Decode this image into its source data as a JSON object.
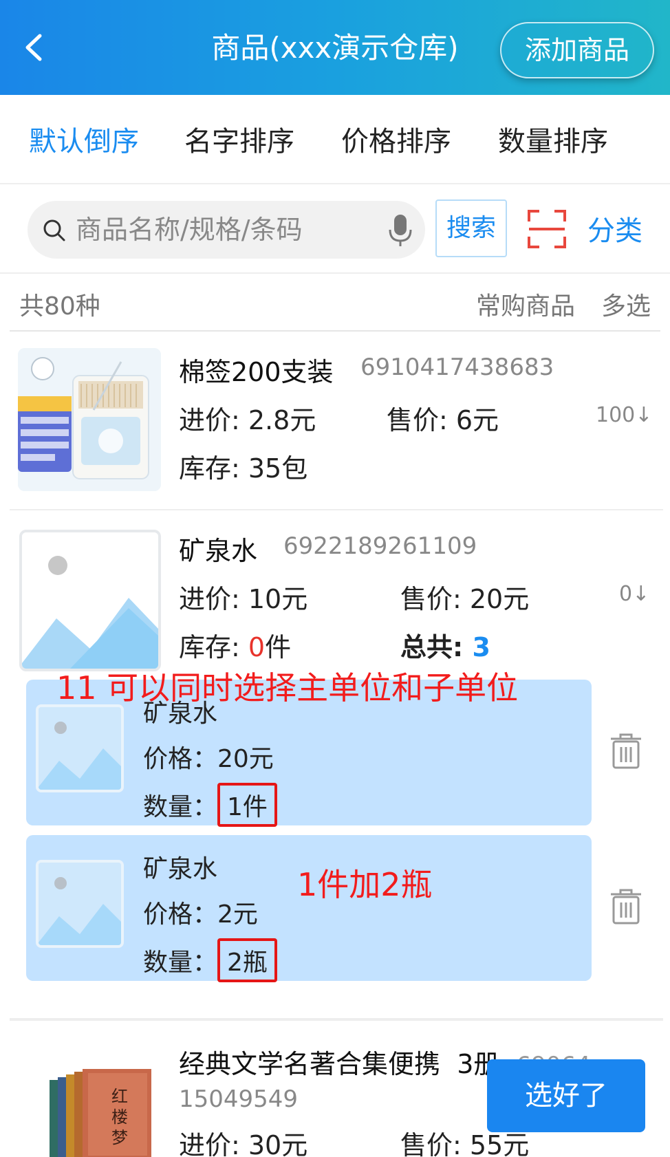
{
  "header": {
    "title": "商品(xxx演示仓库)",
    "add_label": "添加商品"
  },
  "sort_tabs": [
    {
      "label": "默认倒序",
      "active": true
    },
    {
      "label": "名字排序",
      "active": false
    },
    {
      "label": "价格排序",
      "active": false
    },
    {
      "label": "数量排序",
      "active": false
    }
  ],
  "search": {
    "placeholder": "商品名称/规格/条码",
    "button_label": "搜索",
    "category_label": "分类"
  },
  "summary": {
    "total_label": "共80种",
    "frequent_label": "常购商品",
    "multi_label": "多选"
  },
  "products": [
    {
      "name": "棉签200支装",
      "code": "6910417438683",
      "cost": "进价: 2.8元",
      "sale": "售价: 6元",
      "stock": "库存: 35包",
      "side": "100↓"
    },
    {
      "name": "矿泉水",
      "code": "6922189261109",
      "cost": "进价: 10元",
      "sale": "售价: 20元",
      "stock_prefix": "库存: ",
      "stock_value": "0",
      "stock_unit": "件",
      "total_label": "总共: ",
      "total_value": "3",
      "side": "0↓"
    },
    {
      "name": "经典文学名著合集便携",
      "name_suffix": "3册",
      "code_partial": "69064",
      "code": "15049549",
      "cost": "进价: 30元",
      "sale": "售价: 55元"
    }
  ],
  "sub_units": [
    {
      "name": "矿泉水",
      "price": "价格：20元",
      "qty_label": "数量：",
      "qty": "1件"
    },
    {
      "name": "矿泉水",
      "price": "价格：2元",
      "qty_label": "数量：",
      "qty": "2瓶"
    }
  ],
  "annotations": {
    "main": "11 可以同时选择主单位和子单位",
    "combo": "1件加2瓶"
  },
  "done_label": "选好了",
  "colors": {
    "accent": "#1a8cf0",
    "header_start": "#1a86e8",
    "header_end": "#21b6c9",
    "annotation": "#f21c1c",
    "sub_card": "#c3e2ff"
  }
}
